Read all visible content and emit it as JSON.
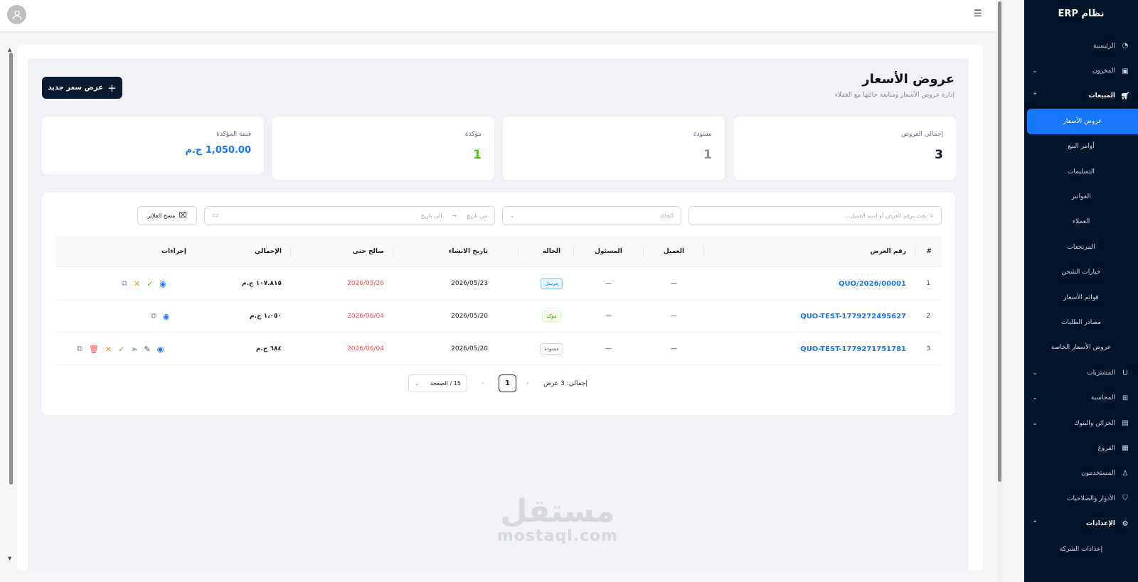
{
  "sidebar": {
    "brand": "نظام ERP",
    "items": [
      {
        "label": "الرئيسية",
        "icon": "dashboard-icon"
      },
      {
        "label": "المخزون",
        "icon": "box-icon",
        "chevron": "down"
      },
      {
        "label": "المبيعات",
        "icon": "cart-icon",
        "chevron": "up",
        "open": true
      },
      {
        "label": "عروض الأسعار",
        "active": true
      },
      {
        "label": "أوامر البيع"
      },
      {
        "label": "التسليمات"
      },
      {
        "label": "الفواتير"
      },
      {
        "label": "العملاء"
      },
      {
        "label": "المرتجعات"
      },
      {
        "label": "خيارات الشحن"
      },
      {
        "label": "قوائم الأسعار"
      },
      {
        "label": "مصادر الطلبات"
      },
      {
        "label": "عروض الأسعار الخاصة"
      },
      {
        "label": "المشتريات",
        "icon": "bag-icon",
        "chevron": "down"
      },
      {
        "label": "المحاسبة",
        "icon": "calculator-icon",
        "chevron": "down"
      },
      {
        "label": "الخزائن والبنوك",
        "icon": "wallet-icon",
        "chevron": "down"
      },
      {
        "label": "الفروع",
        "icon": "building-icon"
      },
      {
        "label": "المستخدمون",
        "icon": "user-icon"
      },
      {
        "label": "الأدوار والصلاحيات",
        "icon": "shield-icon"
      },
      {
        "label": "الإعدادات",
        "icon": "gear-icon",
        "chevron": "up",
        "open": true
      },
      {
        "label": "إعدادات الشركة"
      }
    ]
  },
  "header": {
    "title": "عروض الأسعار",
    "subtitle": "إدارة عروض الأسعار ومتابعة حالتها مع العملاء",
    "new_button": "عرض سعر جديد"
  },
  "stats": [
    {
      "label": "إجمالي العروض",
      "value": "3",
      "color": "#111827"
    },
    {
      "label": "مسودة",
      "value": "1",
      "color": "#8c8c8c"
    },
    {
      "label": "مؤكدة",
      "value": "1",
      "color": "#52c41a"
    },
    {
      "label": "قيمة المؤكدة",
      "value": "1,050.00 ج.م",
      "color": "#1677ff"
    }
  ],
  "filters": {
    "search_placeholder": "بحث برقم العرض أو اسم العميل...",
    "status_placeholder": "الحالة",
    "date_from": "من تاريخ",
    "date_to": "إلى تاريخ",
    "clear_label": "مسح الفلاتر"
  },
  "table": {
    "columns": [
      "#",
      "رقم العرض",
      "العميل",
      "المسئول",
      "الحالة",
      "تاريخ الانشاء",
      "صالح حتى",
      "الإجمالي",
      "إجراءات"
    ],
    "rows": [
      {
        "index": "1",
        "number": "QUO/2026/00001",
        "customer": "—",
        "owner": "—",
        "status": "مرسل",
        "created": "2026/05/23",
        "valid_until": "2026/05/26",
        "total": "١٠٧.٨١٥ ج.م"
      },
      {
        "index": "2",
        "number": "QUO-TEST-1779272495627",
        "customer": "—",
        "owner": "—",
        "status": "مؤكد",
        "created": "2026/05/20",
        "valid_until": "2026/06/04",
        "total": "١،٠٥٠ ج.م"
      },
      {
        "index": "3",
        "number": "QUO-TEST-1779271751781",
        "customer": "—",
        "owner": "—",
        "status": "مسودة",
        "created": "2026/05/20",
        "valid_until": "2026/06/04",
        "total": "٦٨٤ ج.م"
      }
    ]
  },
  "pagination": {
    "total": "إجمالي: 3 عرض",
    "page": "1",
    "page_size": "15 / الصفحة"
  },
  "watermark": {
    "arabic": "مستقل",
    "latin": "mostaql.com"
  }
}
